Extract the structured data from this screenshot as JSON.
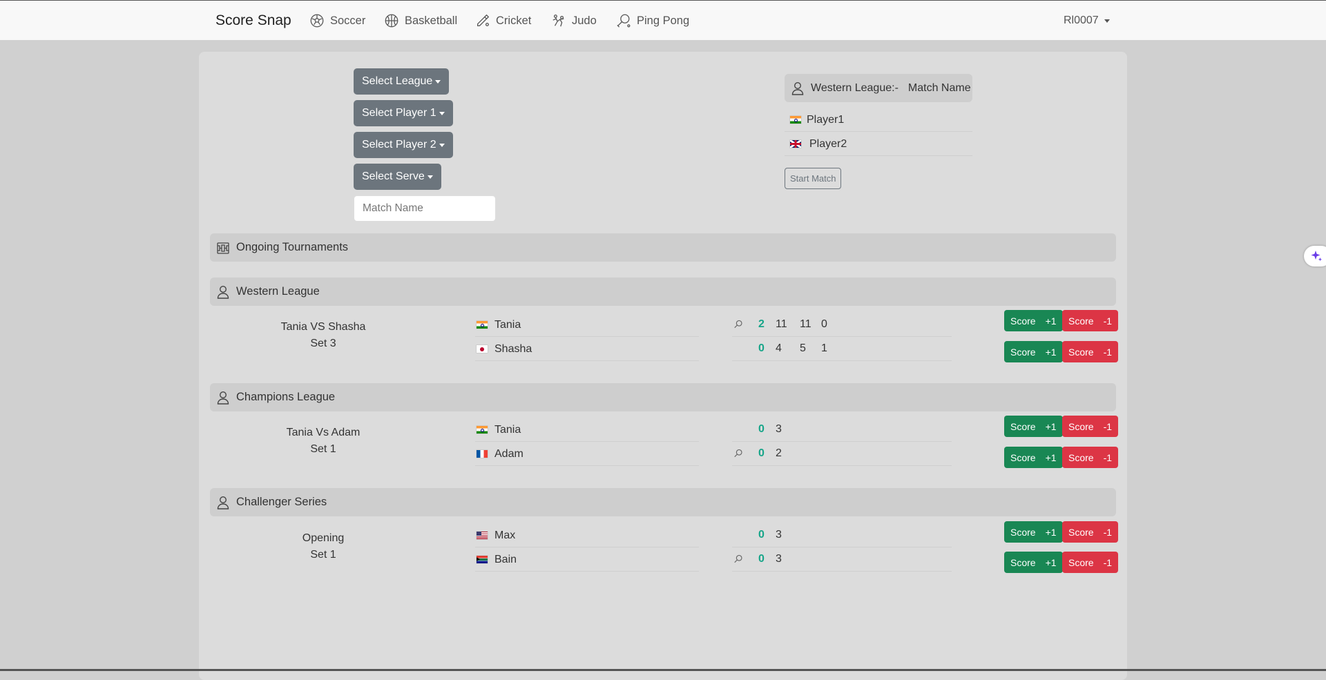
{
  "nav": {
    "brand": "Score Snap",
    "items": [
      {
        "label": "Soccer",
        "icon": "soccer-ball-icon"
      },
      {
        "label": "Basketball",
        "icon": "basketball-icon"
      },
      {
        "label": "Cricket",
        "icon": "cricket-icon"
      },
      {
        "label": "Judo",
        "icon": "judo-icon"
      },
      {
        "label": "Ping Pong",
        "icon": "ping-pong-icon"
      }
    ],
    "user": "Rl0007"
  },
  "form": {
    "select_league": "Select League",
    "select_player1": "Select Player 1",
    "select_player2": "Select Player 2",
    "select_serve": "Select Serve",
    "match_name_placeholder": "Match Name"
  },
  "preview": {
    "league": "Western League:-",
    "match_name": "Match Name",
    "player1": "Player1",
    "player2": "Player2",
    "start_button": "Start Match"
  },
  "ongoing_title": "Ongoing Tournaments",
  "score_plus_label": "Score",
  "score_plus_value": "+1",
  "score_minus_label": "Score",
  "score_minus_value": "-1",
  "leagues": [
    {
      "name": "Western League",
      "match_title": "Tania VS Shasha",
      "set": "Set 3",
      "players": [
        {
          "name": "Tania",
          "flag": "india",
          "serve": true,
          "sets": "2",
          "games": [
            "11",
            "11",
            "0"
          ]
        },
        {
          "name": "Shasha",
          "flag": "japan",
          "serve": false,
          "sets": "0",
          "games": [
            "4",
            "5",
            "1"
          ]
        }
      ]
    },
    {
      "name": "Champions League",
      "match_title": "Tania Vs Adam",
      "set": "Set 1",
      "players": [
        {
          "name": "Tania",
          "flag": "india",
          "serve": false,
          "sets": "0",
          "games": [
            "3"
          ]
        },
        {
          "name": "Adam",
          "flag": "france",
          "serve": true,
          "sets": "0",
          "games": [
            "2"
          ]
        }
      ]
    },
    {
      "name": "Challenger Series",
      "match_title": "Opening",
      "set": "Set 1",
      "players": [
        {
          "name": "Max",
          "flag": "usa",
          "serve": false,
          "sets": "0",
          "games": [
            "3"
          ]
        },
        {
          "name": "Bain",
          "flag": "south-africa",
          "serve": true,
          "sets": "0",
          "games": [
            "3"
          ]
        }
      ]
    }
  ],
  "colors": {
    "score_plus": "#198754",
    "score_minus": "#dc3545",
    "select_button": "#6c757d",
    "sets_text": "#17a589"
  }
}
